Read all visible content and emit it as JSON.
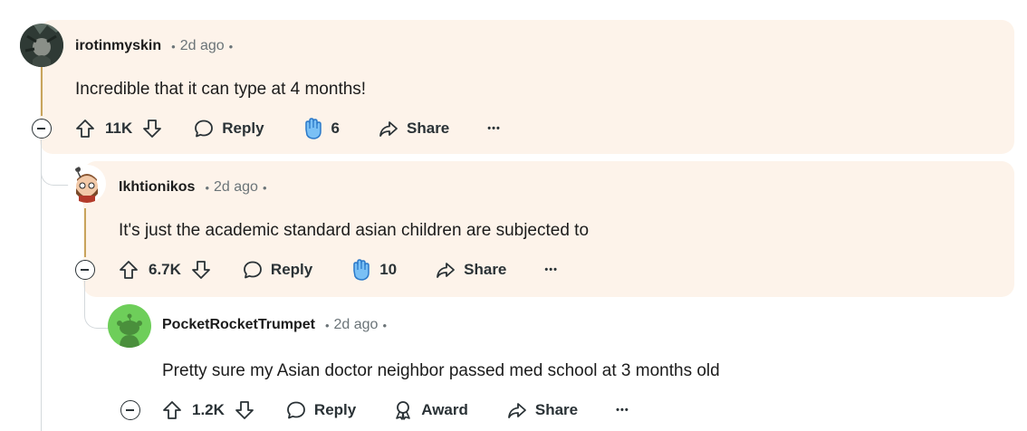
{
  "comments": [
    {
      "author": "irotinmyskin",
      "time": "2d ago",
      "text": "Incredible that it can type at 4 months!",
      "upvotes": "11K",
      "reply_label": "Reply",
      "award_count": "6",
      "share_label": "Share",
      "more_label": "•••",
      "highlighted": true
    },
    {
      "author": "Ikhtionikos",
      "time": "2d ago",
      "text": "It's just the academic standard asian children are subjected to",
      "upvotes": "6.7K",
      "reply_label": "Reply",
      "award_count": "10",
      "share_label": "Share",
      "more_label": "•••",
      "highlighted": true
    },
    {
      "author": "PocketRocketTrumpet",
      "time": "2d ago",
      "text": "Pretty sure my Asian doctor neighbor passed med school at 3 months old",
      "upvotes": "1.2K",
      "reply_label": "Reply",
      "award_label": "Award",
      "share_label": "Share",
      "more_label": "•••",
      "highlighted": false
    }
  ],
  "separator": "•",
  "colors": {
    "highlight_bg": "#fdf3ea",
    "thread_line_active": "#c8a45d",
    "thread_line": "#d4d9dc",
    "text_primary": "#1c1c1c",
    "text_meta": "#6b7478",
    "award_blue": "#3d9bec",
    "snoo_green": "#6ece5a"
  },
  "icons": {
    "upvote": "upvote-arrow-icon",
    "downvote": "downvote-arrow-icon",
    "reply": "speech-bubble-icon",
    "award_given": "clapping-hands-icon",
    "award": "award-ribbon-icon",
    "share": "share-arrow-icon",
    "collapse": "minus-circle-icon"
  }
}
